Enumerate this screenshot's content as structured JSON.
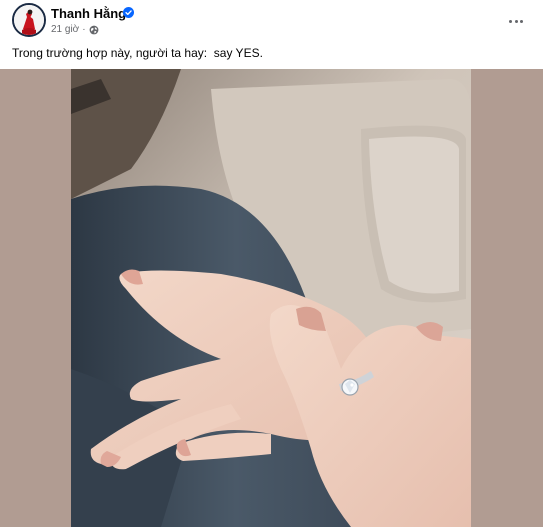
{
  "post": {
    "author": "Thanh Hằng",
    "time": "21 giờ",
    "separator": "·",
    "caption": "Trong trường hợp này, người ta hay:  say YES."
  },
  "icons": {
    "verified": "verified-badge-icon",
    "privacy": "globe-icon",
    "menu": "more-options-icon"
  },
  "colors": {
    "verified_blue": "#0866ff",
    "secondary_text": "#65676b",
    "photo_backdrop": "#b19c92"
  }
}
